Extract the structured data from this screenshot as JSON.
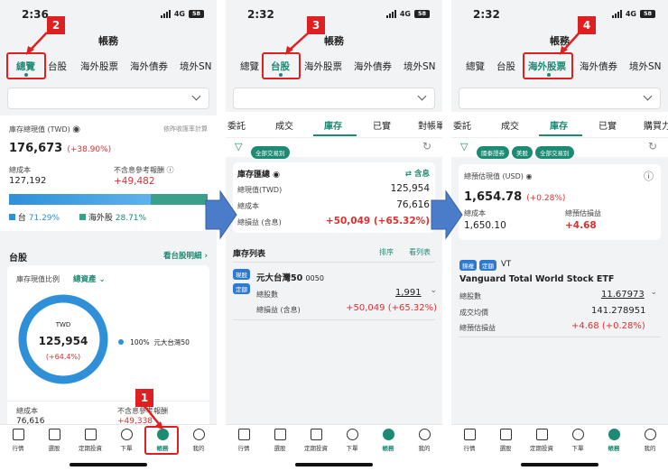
{
  "p1": {
    "time": "2:36",
    "net": "4G",
    "bat": "58",
    "title": "帳務",
    "tabs": [
      "總覽",
      "台股",
      "海外股票",
      "海外債券",
      "境外SN"
    ],
    "total_label": "庫存總現值 (TWD)",
    "calc_note": "依昨收匯率計算",
    "total_value": "176,673",
    "total_pct": "(+38.90%)",
    "cost_label": "總成本",
    "cost_value": "127,192",
    "ref_label": "不含息參考報酬",
    "ref_value": "+49,482",
    "tw_label": "台",
    "tw_pct": "71.29%",
    "ov_label": "海外股",
    "ov_pct": "28.71%",
    "tw_share": 71.29,
    "sec_title": "台股",
    "sec_link": "看台股明細",
    "ratio_label": "庫存現值比例",
    "ratio_select": "總資產",
    "donut_cur": "TWD",
    "donut_value": "125,954",
    "donut_pct": "(+64.4%)",
    "legend_pct": "100%",
    "legend_name": "元大台灣50",
    "bot_cost_label": "總成本",
    "bot_cost_value": "76,616",
    "bot_ref_label": "不含息參考報酬",
    "bot_ref_value": "+49,338"
  },
  "p2": {
    "time": "2:32",
    "net": "4G",
    "bat": "58",
    "title": "帳務",
    "tabs": [
      "總覽",
      "台股",
      "海外股票",
      "海外債券",
      "境外SN"
    ],
    "subtabs": [
      "委託",
      "成交",
      "庫存",
      "已實",
      "對帳單"
    ],
    "chip": "全部交易別",
    "sum_title": "庫存匯總",
    "sum_toggle": "含息",
    "mv_label": "總現值(TWD)",
    "mv_value": "125,954",
    "cost_label": "總成本",
    "cost_value": "76,616",
    "pl_label": "總損益 (含息)",
    "pl_value": "+50,049 (+65.32%)",
    "list_title": "庫存列表",
    "sort": "排序",
    "view": "看列表",
    "tag1": "現股",
    "tag2": "定額",
    "stock_name": "元大台灣50",
    "stock_code": "0050",
    "shares_label": "總股數",
    "shares_value": "1,991",
    "spl_label": "總損益 (含息)",
    "spl_value": "+50,049 (+65.32%)"
  },
  "p3": {
    "time": "2:32",
    "net": "4G",
    "bat": "58",
    "title": "帳務",
    "tabs": [
      "總覽",
      "台股",
      "海外股票",
      "海外債券",
      "境外SN"
    ],
    "subtabs": [
      "委託",
      "成交",
      "庫存",
      "已實",
      "購買力"
    ],
    "chips": [
      "國泰證券",
      "美股",
      "全部交易別"
    ],
    "est_label": "總預估現值 (USD)",
    "est_value": "1,654.78",
    "est_pct": "(+0.28%)",
    "cost_label": "總成本",
    "cost_value": "1,650.10",
    "epl_label": "總預估損益",
    "epl_value": "+4.68",
    "tag1": "錦複",
    "tag2": "定額",
    "ticker": "VT",
    "fund_name": "Vanguard Total World Stock ETF",
    "units_label": "總股數",
    "units_value": "11.67973",
    "avg_label": "成交均價",
    "avg_value": "141.278951",
    "fpl_label": "總預估損益",
    "fpl_value": "+4.68 (+0.28%)"
  },
  "nav": [
    "行情",
    "選股",
    "定期投資",
    "下單",
    "帳務",
    "我的"
  ],
  "steps": [
    "1",
    "2",
    "3",
    "4"
  ],
  "colors": {
    "accent": "#1d8a74",
    "red": "#e02f2f",
    "blue": "#2d7ad0",
    "arrow": "#4a7cc9"
  }
}
